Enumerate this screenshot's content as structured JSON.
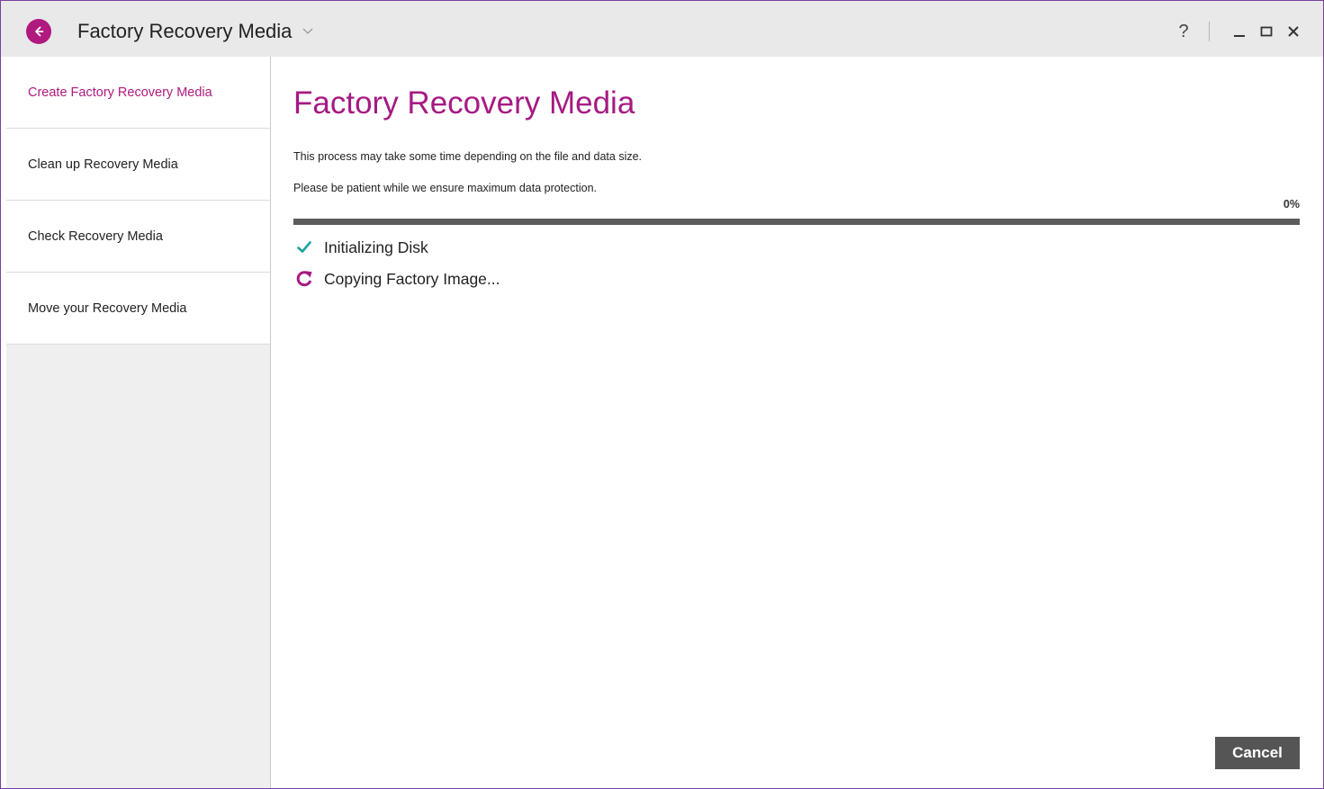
{
  "window": {
    "title": "Factory Recovery Media",
    "help_label": "?"
  },
  "sidebar": {
    "items": [
      {
        "label": "Create Factory Recovery Media",
        "active": true
      },
      {
        "label": "Clean up Recovery Media",
        "active": false
      },
      {
        "label": "Check Recovery Media",
        "active": false
      },
      {
        "label": "Move your Recovery Media",
        "active": false
      }
    ]
  },
  "main": {
    "title": "Factory Recovery Media",
    "description_line1": "This process may take some time depending on the file and data size.",
    "description_line2": "Please be patient while we ensure maximum data protection.",
    "progress_percent_label": "0%",
    "progress_value": 0,
    "steps": [
      {
        "label": "Initializing Disk",
        "status": "done",
        "icon": "check-icon"
      },
      {
        "label": "Copying Factory Image...",
        "status": "in-progress",
        "icon": "refresh-icon"
      }
    ],
    "cancel_label": "Cancel"
  },
  "colors": {
    "accent": "#a61a83",
    "check": "#1aa5a0",
    "progress_track": "#5c5c5c",
    "button_bg": "#555555"
  }
}
